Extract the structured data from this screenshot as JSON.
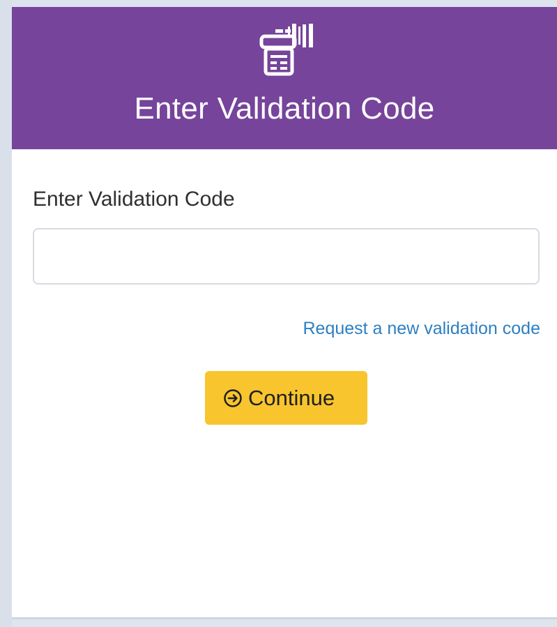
{
  "header": {
    "icon": "receipt-printer-icon",
    "title": "Enter Validation Code"
  },
  "form": {
    "label": "Enter Validation Code",
    "input_value": "",
    "placeholder": ""
  },
  "links": {
    "request_new_code": "Request a new validation code"
  },
  "actions": {
    "continue_icon": "arrow-circle-right-icon",
    "continue_label": "Continue"
  },
  "colors": {
    "header_background": "#76449b",
    "button_background": "#f8c52e",
    "link": "#2d7fc1"
  }
}
